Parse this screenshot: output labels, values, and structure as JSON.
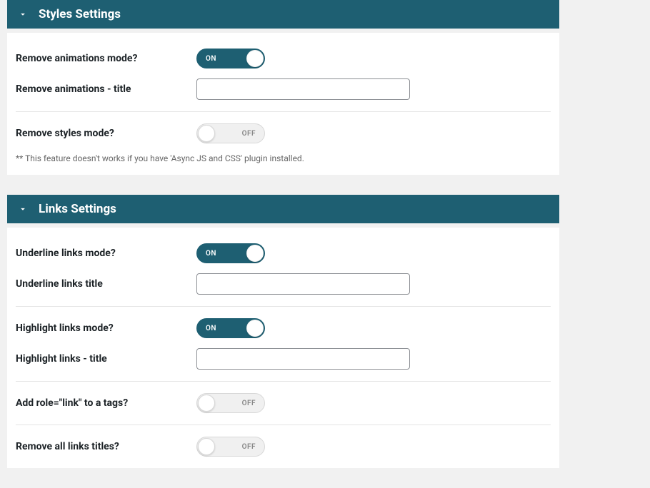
{
  "sections": {
    "styles": {
      "title": "Styles Settings",
      "fields": {
        "remove_animations_mode": {
          "label": "Remove animations mode?",
          "toggle_state": "on",
          "toggle_text": "ON"
        },
        "remove_animations_title": {
          "label": "Remove animations - title",
          "value": ""
        },
        "remove_styles_mode": {
          "label": "Remove styles mode?",
          "toggle_state": "off",
          "toggle_text": "OFF"
        }
      },
      "note": "** This feature doesn't works if you have 'Async JS and CSS' plugin installed."
    },
    "links": {
      "title": "Links Settings",
      "fields": {
        "underline_links_mode": {
          "label": "Underline links mode?",
          "toggle_state": "on",
          "toggle_text": "ON"
        },
        "underline_links_title": {
          "label": "Underline links title",
          "value": ""
        },
        "highlight_links_mode": {
          "label": "Highlight links mode?",
          "toggle_state": "on",
          "toggle_text": "ON"
        },
        "highlight_links_title": {
          "label": "Highlight links - title",
          "value": ""
        },
        "add_role_link": {
          "label": "Add role=\"link\" to a tags?",
          "toggle_state": "off",
          "toggle_text": "OFF"
        },
        "remove_all_links_titles": {
          "label": "Remove all links titles?",
          "toggle_state": "off",
          "toggle_text": "OFF"
        }
      }
    }
  }
}
